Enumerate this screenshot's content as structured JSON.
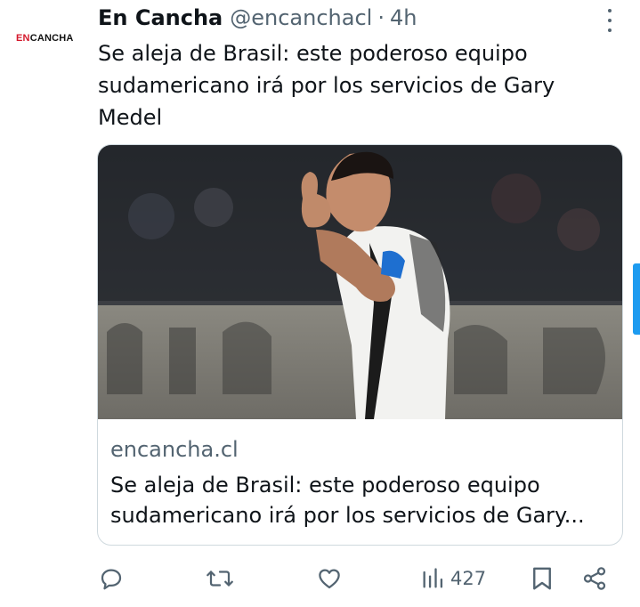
{
  "avatar": {
    "logo_part1": "EN",
    "logo_part2": "CANCHA"
  },
  "tweet": {
    "author": "En Cancha",
    "handle": "@encanchacl",
    "separator": "·",
    "time": "4h",
    "text": "Se aleja de Brasil: este poderoso equipo sudamericano irá por los servicios de Gary Medel"
  },
  "card": {
    "domain": "encancha.cl",
    "title": "Se aleja de Brasil: este poderoso equipo sudamericano irá por los servicios de Gary..."
  },
  "actions": {
    "views": "427",
    "icons": [
      "reply-icon",
      "retweet-icon",
      "like-icon",
      "views-icon",
      "bookmark-icon",
      "share-icon"
    ]
  },
  "colors": {
    "text": "#0f1419",
    "secondary": "#536471",
    "border": "#cfd9de",
    "brand_red": "#d4182b",
    "accent": "#1d9bf0"
  }
}
